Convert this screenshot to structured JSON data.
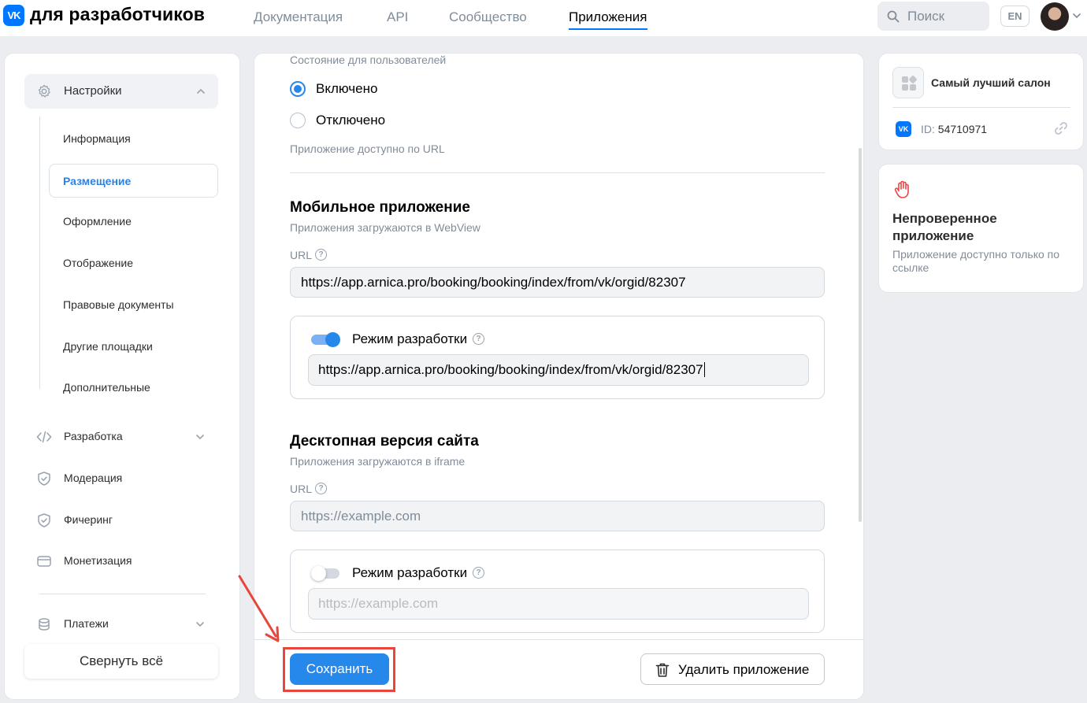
{
  "header": {
    "logo_mark": "VK",
    "logo_text": "для разработчиков",
    "nav": [
      "Документация",
      "API",
      "Сообщество",
      "Приложения"
    ],
    "active_nav": "Приложения",
    "search_placeholder": "Поиск",
    "lang": "EN"
  },
  "sidebar": {
    "settings_label": "Настройки",
    "sub_items": [
      "Информация",
      "Размещение",
      "Оформление",
      "Отображение",
      "Правовые документы",
      "Другие площадки",
      "Дополнительные"
    ],
    "active_sub": "Размещение",
    "items": [
      {
        "label": "Разработка",
        "icon": "code-icon",
        "expandable": true
      },
      {
        "label": "Модерация",
        "icon": "shield-check-icon",
        "expandable": false
      },
      {
        "label": "Фичеринг",
        "icon": "shield-check-icon",
        "expandable": false
      },
      {
        "label": "Монетизация",
        "icon": "card-icon",
        "expandable": false
      },
      {
        "label": "Платежи",
        "icon": "coins-icon",
        "expandable": true
      }
    ],
    "collapse_all": "Свернуть всё"
  },
  "main": {
    "state_caption": "Состояние для пользователей",
    "state_options": [
      {
        "label": "Включено",
        "selected": true
      },
      {
        "label": "Отключено",
        "selected": false
      }
    ],
    "state_hint": "Приложение доступно по URL",
    "mobile": {
      "title": "Мобильное приложение",
      "subtitle": "Приложения загружаются в WebView",
      "url_label": "URL",
      "url_value": "https://app.arnica.pro/booking/booking/index/from/vk/orgid/82307",
      "dev_mode_label": "Режим разработки",
      "dev_mode_on": true,
      "dev_url_value": "https://app.arnica.pro/booking/booking/index/from/vk/orgid/82307"
    },
    "desktop": {
      "title": "Десктопная версия сайта",
      "subtitle": "Приложения загружаются в iframe",
      "url_label": "URL",
      "url_placeholder": "https://example.com",
      "dev_mode_label": "Режим разработки",
      "dev_mode_on": false,
      "dev_url_placeholder": "https://example.com"
    },
    "help_glyph": "?",
    "save_button": "Сохранить",
    "delete_button": "Удалить приложение"
  },
  "app_card": {
    "name": "Самый лучший салон",
    "id_label": "ID:",
    "id_value": "54710971",
    "vk_mark": "VK"
  },
  "warning_card": {
    "title": "Непроверенное приложение",
    "description": "Приложение доступно только по ссылке"
  },
  "colors": {
    "accent": "#2688eb",
    "brand": "#0077ff",
    "annotation": "#e8453c"
  }
}
